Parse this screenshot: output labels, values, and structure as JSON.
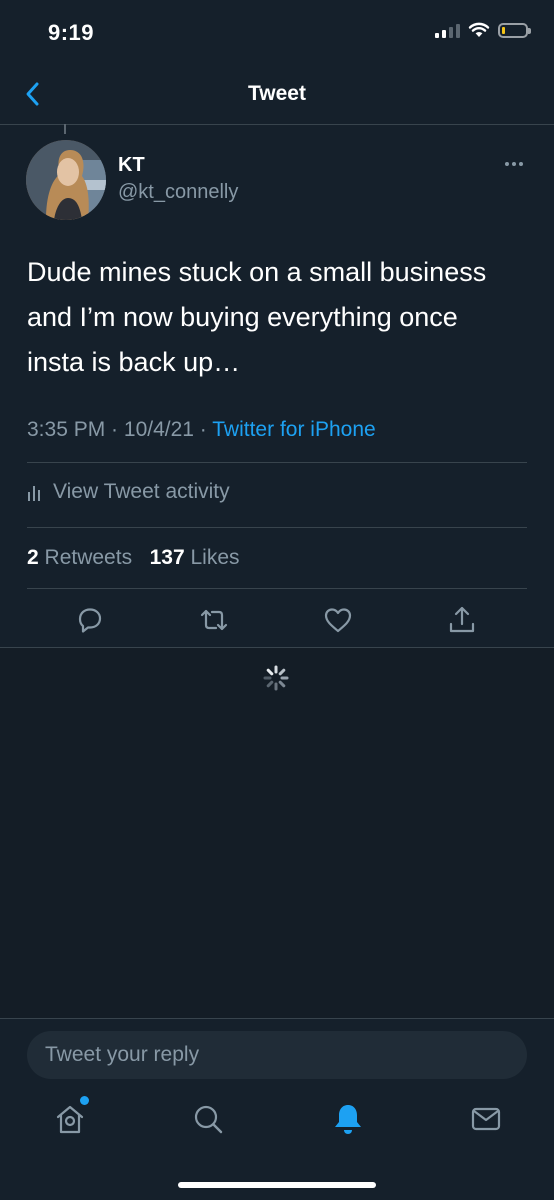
{
  "status_bar": {
    "time": "9:19",
    "icons": [
      "cellular-signal-icon",
      "wifi-icon",
      "battery-icon"
    ],
    "battery_level": 0.15,
    "battery_color": "#f5c518"
  },
  "nav": {
    "title": "Tweet",
    "back_icon": "chevron-left-icon"
  },
  "tweet": {
    "author_name": "KT",
    "author_handle": "@kt_connelly",
    "text": "Dude mines stuck on a small business and I’m now buying everything once insta is back up…",
    "time": "3:35 PM",
    "date": "10/4/21",
    "meta_sep": " · ",
    "source": "Twitter for iPhone",
    "activity_label": "View Tweet activity",
    "retweet_count": "2",
    "retweet_label": "Retweets",
    "like_count": "137",
    "like_label": "Likes",
    "actions": [
      "reply-icon",
      "retweet-icon",
      "like-icon",
      "share-icon"
    ]
  },
  "reply": {
    "placeholder": "Tweet your reply"
  },
  "tabbar": {
    "items": [
      "home-icon",
      "search-icon",
      "notifications-icon",
      "messages-icon"
    ],
    "active": "notifications-icon"
  },
  "colors": {
    "background": "#15202b",
    "accent": "#1da1f2",
    "secondary_text": "#8899a6",
    "border": "#38444d"
  }
}
